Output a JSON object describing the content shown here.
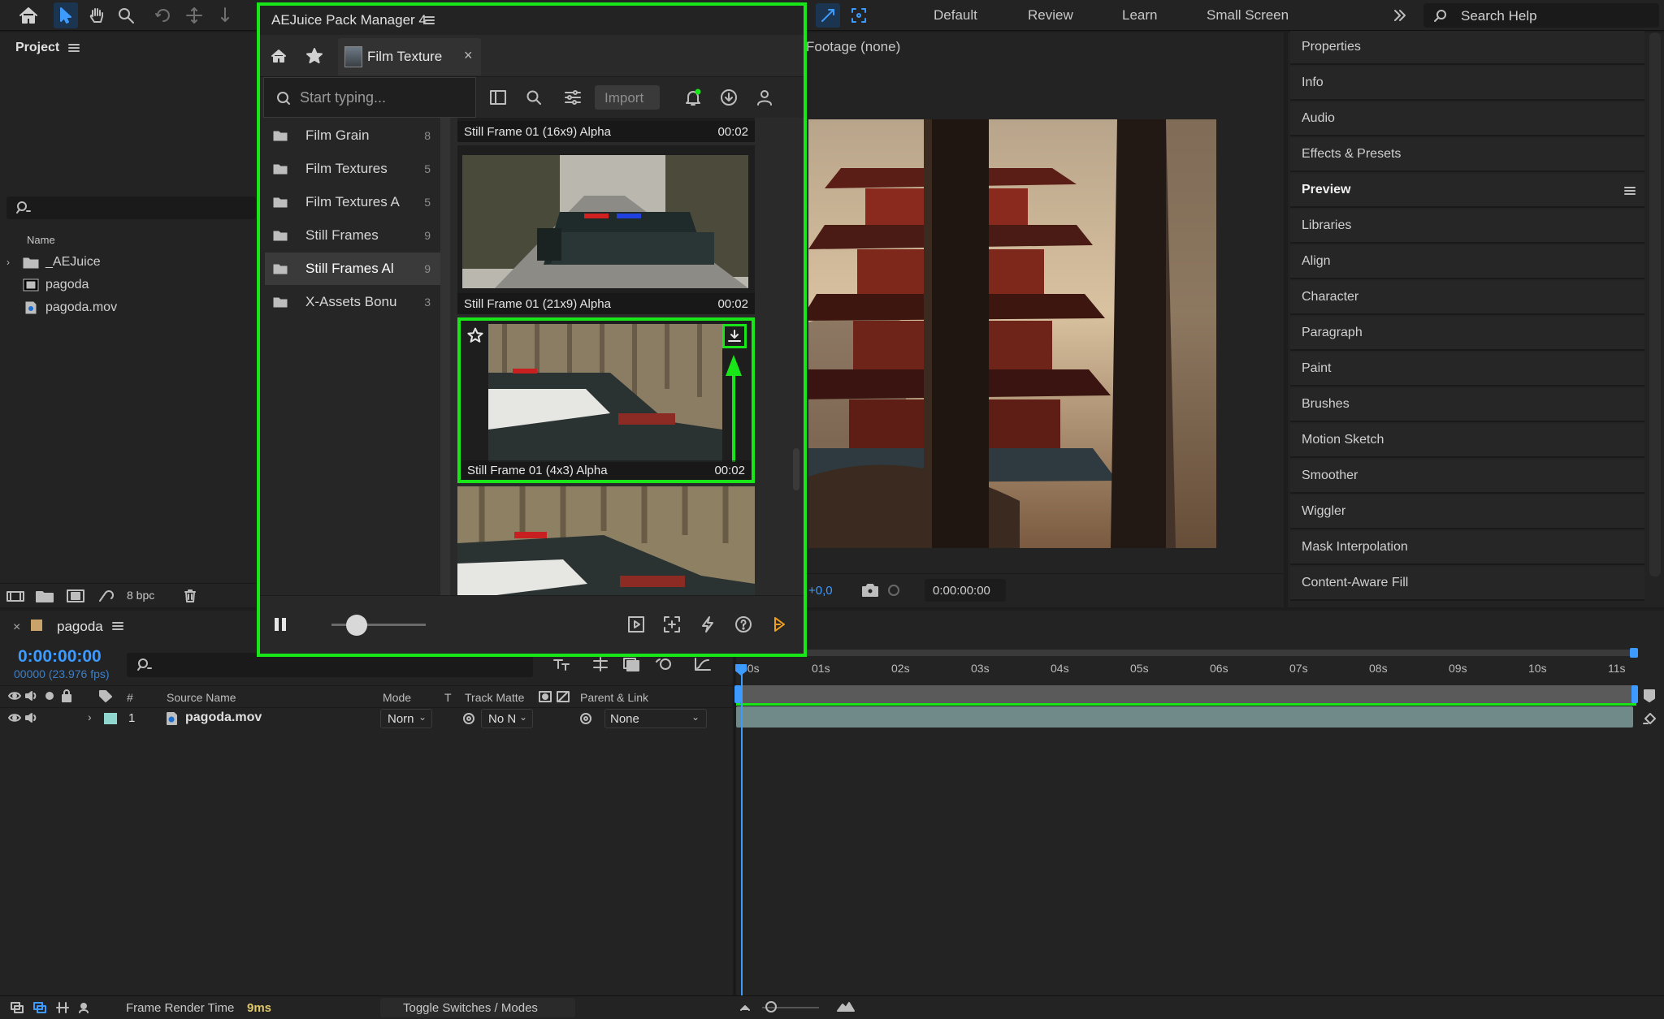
{
  "toolbar": {
    "workspaces": [
      "Default",
      "Review",
      "Learn",
      "Small Screen"
    ],
    "search_help": "Search Help"
  },
  "project": {
    "title": "Project",
    "column_name": "Name",
    "items": [
      {
        "name": "_AEJuice",
        "type": "folder"
      },
      {
        "name": "pagoda",
        "type": "composition"
      },
      {
        "name": "pagoda.mov",
        "type": "footage"
      }
    ],
    "bit_depth": "8 bpc"
  },
  "viewer": {
    "footage_label": "Footage (none)",
    "exposure": "+0,0",
    "timecode": "0:00:00:00"
  },
  "right_panels": {
    "items": [
      "Properties",
      "Info",
      "Audio",
      "Effects & Presets",
      "Preview",
      "Libraries",
      "Align",
      "Character",
      "Paragraph",
      "Paint",
      "Brushes",
      "Motion Sketch",
      "Smoother",
      "Wiggler",
      "Mask Interpolation",
      "Content-Aware Fill"
    ],
    "active": "Preview"
  },
  "aejuice": {
    "title": "AEJuice Pack Manager 4",
    "tab_label": "Film Texture",
    "search_placeholder": "Start typing...",
    "import_label": "Import",
    "categories": [
      {
        "name": "Film Grain",
        "count": "8"
      },
      {
        "name": "Film Textures",
        "count": "5"
      },
      {
        "name": "Film Textures A",
        "count": "5"
      },
      {
        "name": "Still Frames",
        "count": "9"
      },
      {
        "name": "Still Frames Al",
        "count": "9"
      },
      {
        "name": "X-Assets Bonu",
        "count": "3"
      }
    ],
    "selected_category": "Still Frames Al",
    "assets": [
      {
        "name": "Still Frame 01 (16x9) Alpha",
        "duration": "00:02"
      },
      {
        "name": "Still Frame 01 (21x9) Alpha",
        "duration": "00:02"
      },
      {
        "name": "Still Frame 01 (4x3) Alpha",
        "duration": "00:02"
      },
      {
        "name": "",
        "duration": ""
      }
    ],
    "zoom_level": 0.27
  },
  "timeline": {
    "comp_name": "pagoda",
    "timecode": "0:00:00:00",
    "frames_fps": "00000 (23.976 fps)",
    "ruler": [
      "00s",
      "01s",
      "02s",
      "03s",
      "04s",
      "05s",
      "06s",
      "07s",
      "08s",
      "09s",
      "10s",
      "11s"
    ],
    "headers": {
      "num": "#",
      "source": "Source Name",
      "mode": "Mode",
      "t": "T",
      "matte": "Track Matte",
      "parent": "Parent & Link"
    },
    "layers": [
      {
        "index": "1",
        "name": "pagoda.mov",
        "mode": "Norn",
        "matte": "No N",
        "parent": "None"
      }
    ]
  },
  "status": {
    "render_label": "Frame Render Time",
    "render_value": "9ms",
    "toggle_label": "Toggle Switches / Modes"
  },
  "colors": {
    "highlight": "#19e619",
    "accent_blue": "#2f8fff"
  }
}
